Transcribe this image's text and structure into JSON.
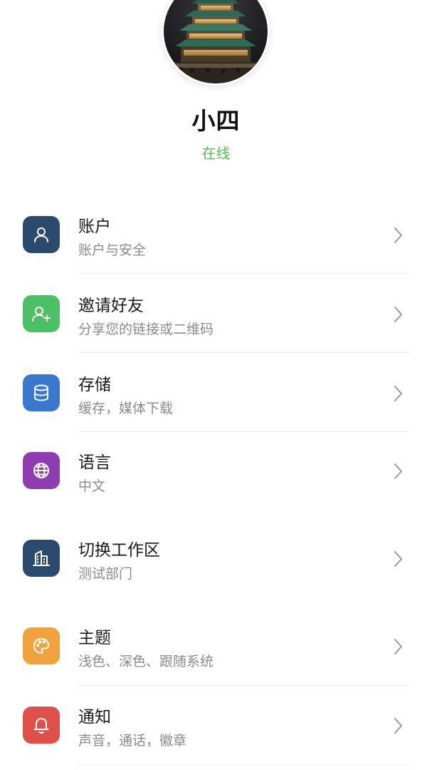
{
  "profile": {
    "name": "小四",
    "status": "在线",
    "status_color": "#5cb85c"
  },
  "menu": {
    "items": [
      {
        "title": "账户",
        "subtitle": "账户与安全",
        "icon": "user-icon",
        "color": "#2c4a6e"
      },
      {
        "title": "邀请好友",
        "subtitle": "分享您的链接或二维码",
        "icon": "add-user-icon",
        "color": "#4cc065"
      },
      {
        "title": "存储",
        "subtitle": "缓存，媒体下载",
        "icon": "database-icon",
        "color": "#3a78d0"
      },
      {
        "title": "语言",
        "subtitle": "中文",
        "icon": "globe-icon",
        "color": "#8e3cb0"
      },
      {
        "title": "切换工作区",
        "subtitle": "测试部门",
        "icon": "building-icon",
        "color": "#2c4a6e"
      },
      {
        "title": "主题",
        "subtitle": "浅色、深色、跟随系统",
        "icon": "palette-icon",
        "color": "#f0a23c"
      },
      {
        "title": "通知",
        "subtitle": "声音，通话，徽章",
        "icon": "bell-icon",
        "color": "#e0504a"
      }
    ]
  }
}
